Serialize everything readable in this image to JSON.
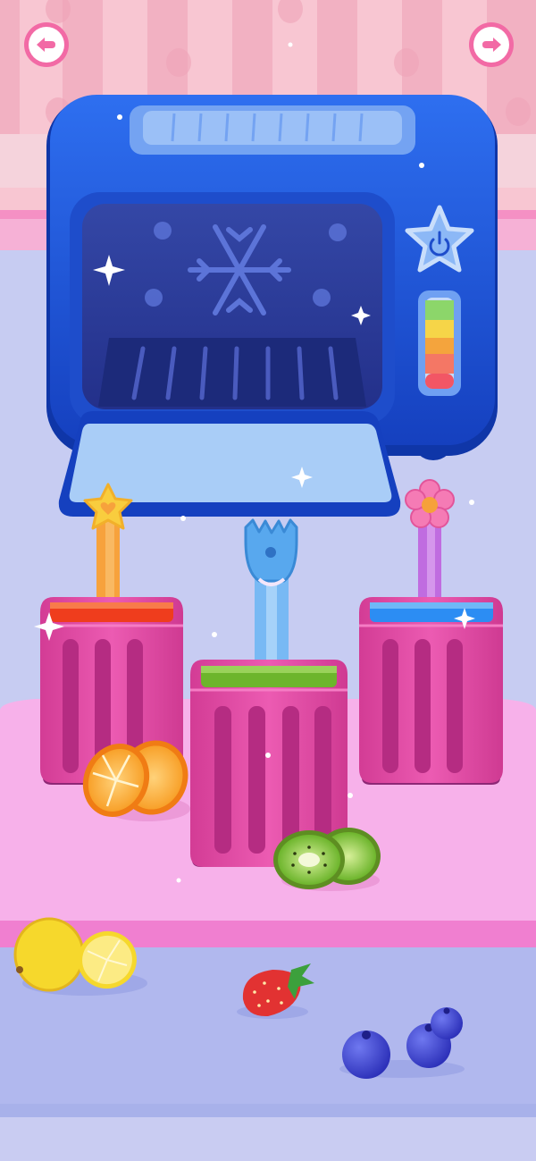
{
  "colors": {
    "wall": "#F8C2CF",
    "wall_stripe": "#F3AFC0",
    "floor": "#C6CBF1",
    "table_top": "#F7AEE8",
    "table_edge": "#F07FCC",
    "freezer_blue": "#1D52D9",
    "freezer_dark": "#0F36A8",
    "freezer_window": "#2A3C98",
    "freezer_door": "#A9CDF7",
    "mold_pink": "#E0459F",
    "mold_dark": "#B52C82",
    "juice_red": "#EF3D1D",
    "juice_green": "#7BC53A",
    "juice_blue": "#2C8DF3",
    "stick_orange": "#F7A23C",
    "stick_blue": "#78B9F4",
    "stick_purple": "#C06CE0"
  },
  "icons": {
    "back": "back-arrow-icon",
    "next": "next-arrow-icon",
    "power": "power-icon",
    "snowflake": "snowflake-icon"
  },
  "freezer": {
    "temperature_levels": [
      "green",
      "yellow",
      "orange",
      "red"
    ]
  },
  "molds": [
    {
      "name": "left-popsicle-mold",
      "juice": "red",
      "stick_topper": "star-flower"
    },
    {
      "name": "middle-popsicle-mold",
      "juice": "green",
      "stick_topper": "fork"
    },
    {
      "name": "right-popsicle-mold",
      "juice": "blue",
      "stick_topper": "daisy"
    }
  ],
  "fruits": [
    "orange",
    "kiwi",
    "lemon",
    "strawberry",
    "blueberry"
  ]
}
